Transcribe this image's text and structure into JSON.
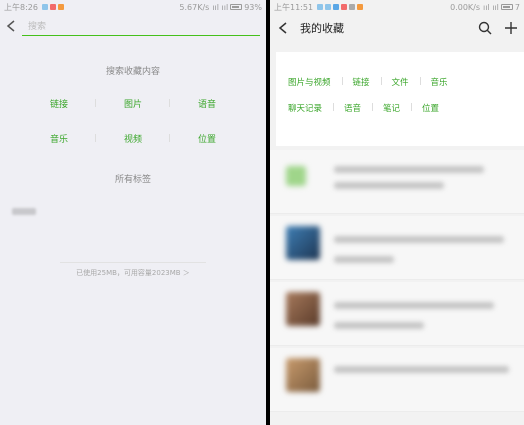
{
  "left_screen": {
    "status": {
      "time": "上午8:26",
      "speed": "5.67K/s",
      "battery": "93%"
    },
    "search": {
      "placeholder": "搜索"
    },
    "search_section": {
      "title": "搜索收藏内容",
      "items": [
        "链接",
        "图片",
        "语音",
        "音乐",
        "视频",
        "位置"
      ]
    },
    "tags_section": {
      "title": "所有标签"
    },
    "storage_text": "已使用25MB，可用容量2023MB ＞"
  },
  "right_screen": {
    "status": {
      "time": "上午11:51",
      "speed": "0.00K/s",
      "battery": "7"
    },
    "title": "我的收藏",
    "filters_row1": [
      "图片与视频",
      "链接",
      "文件",
      "音乐"
    ],
    "filters_row2": [
      "聊天记录",
      "语音",
      "笔记",
      "位置"
    ]
  },
  "colors": {
    "accent": "#3aa62a",
    "divider": "#45c01a"
  },
  "icons": [
    "back-arrow-icon",
    "search-icon",
    "add-icon",
    "wifi-icon",
    "signal-icon",
    "battery-icon"
  ]
}
